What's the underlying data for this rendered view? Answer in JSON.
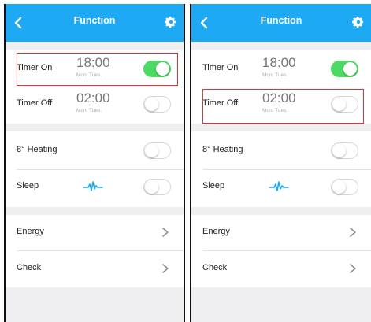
{
  "screens": [
    {
      "header": {
        "title": "Function"
      },
      "timer_on": {
        "label": "Timer On",
        "time": "18:00",
        "days": "Mon. Tues.",
        "enabled": true
      },
      "timer_off": {
        "label": "Timer Off",
        "time": "02:00",
        "days": "Mon. Tues.",
        "enabled": false
      },
      "heating": {
        "label": "8° Heating",
        "enabled": false
      },
      "sleep": {
        "label": "Sleep",
        "enabled": false
      },
      "energy": {
        "label": "Energy"
      },
      "check": {
        "label": "Check"
      },
      "highlighted": "timer_on"
    },
    {
      "header": {
        "title": "Function"
      },
      "timer_on": {
        "label": "Timer On",
        "time": "18:00",
        "days": "Mon. Tues.",
        "enabled": true
      },
      "timer_off": {
        "label": "Timer Off",
        "time": "02:00",
        "days": "Mon. Tues.",
        "enabled": false
      },
      "heating": {
        "label": "8° Heating",
        "enabled": false
      },
      "sleep": {
        "label": "Sleep",
        "enabled": false
      },
      "energy": {
        "label": "Energy"
      },
      "check": {
        "label": "Check"
      },
      "highlighted": "timer_off"
    }
  ],
  "colors": {
    "header": "#1ea9f4",
    "toggle_on": "#4cd964",
    "highlight": "#e03434",
    "sleep_icon": "#1ea9f4",
    "background": "#efeff1"
  },
  "icons": {
    "back": "chevron-left-icon",
    "settings": "gear-icon",
    "sleep": "heartbeat-icon",
    "row_chevron": "chevron-right-icon"
  }
}
